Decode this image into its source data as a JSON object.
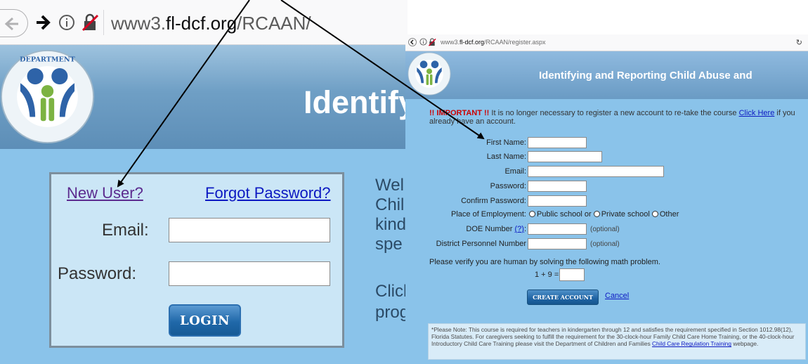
{
  "left": {
    "url_prefix": "www3.",
    "url_domain": "fl-dcf.org",
    "url_path": "/RCAAN/",
    "header_title": "Identify",
    "new_user": "New User?",
    "forgot_password": "Forgot Password?",
    "email_label": "Email:",
    "password_label": "Password:",
    "email_value": "",
    "password_value": "",
    "login_label": "LOGIN",
    "welcome_lines": [
      "Wel",
      "Chil",
      "kind",
      "spe"
    ],
    "click_lines": [
      "Click",
      "prog"
    ]
  },
  "right": {
    "url_prefix": "www3.",
    "url_domain": "fl-dcf.org",
    "url_path": "/RCAAN/register.aspx",
    "header_title": "Identifying and Reporting Child Abuse and",
    "important_tag": "!! IMPORTANT !!",
    "important_text": " It is no longer necessary to register a new account to re-take the course ",
    "click_here": "Click Here",
    "important_tail": " if you already have an account.",
    "fields": {
      "first_name": "First Name:",
      "last_name": "Last Name:",
      "email": "Email:",
      "password": "Password:",
      "confirm_password": "Confirm Password:",
      "place_of_employment": "Place of Employment:",
      "doe_number": "DOE Number",
      "doe_help": "(?)",
      "doe_colon": ":",
      "district_personnel": "District Personnel Number"
    },
    "employment_options": [
      "Public school or",
      "Private school",
      "Other"
    ],
    "optional": "(optional)",
    "verify_text": "Please verify you are human by solving the following math problem.",
    "math_problem": "1 + 9 =",
    "math_answer": "",
    "create_account": "CREATE ACCOUNT",
    "cancel": "Cancel",
    "note_text": "*Please Note: This course is required for teachers in kindergarten through 12 and satisfies the requirement specified in Section 1012.98(12), Florida Statutes. For caregivers seeking to fulfill the requirement for the 30-clock-hour Family Child Care Home Training, or the 40-clock-hour Introductory Child Care Training please visit the Department of Children and Families ",
    "note_link": "Child Care Regulation Training",
    "note_tail": " webpage."
  },
  "colors": {
    "header_blue": "#6f9fc5",
    "body_blue": "#8ac3ea",
    "login_box": "#cbe6f6",
    "link_blue": "#0c19c2",
    "visited_purple": "#5c2b8f",
    "important_red": "#cc0000",
    "button_blue": "#2068a9"
  },
  "icons": [
    "back-arrow-icon",
    "forward-arrow-icon",
    "info-icon",
    "insecure-lock-icon",
    "reload-icon",
    "dcf-logo"
  ]
}
